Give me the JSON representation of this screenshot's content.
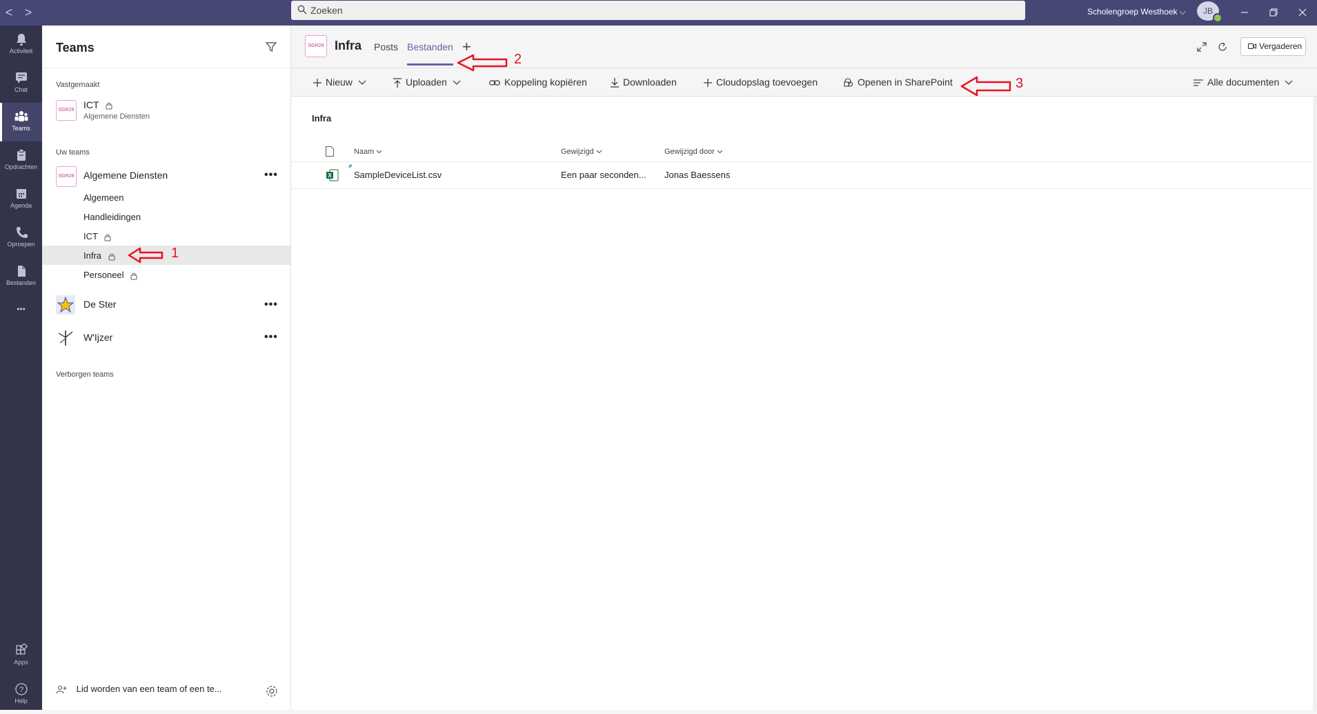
{
  "titlebar": {
    "back": "<",
    "forward": ">",
    "search_placeholder": "Zoeken",
    "org_name": "Scholengroep Westhoek ⌵",
    "avatar_initials": "JB"
  },
  "appbar": {
    "items": [
      {
        "label": "Activiteit",
        "icon": "bell-icon"
      },
      {
        "label": "Chat",
        "icon": "chat-icon"
      },
      {
        "label": "Teams",
        "icon": "teams-icon"
      },
      {
        "label": "Opdrachten",
        "icon": "assignments-icon"
      },
      {
        "label": "Agenda",
        "icon": "calendar-icon"
      },
      {
        "label": "Oproepen",
        "icon": "phone-icon"
      },
      {
        "label": "Bestanden",
        "icon": "file-icon"
      }
    ],
    "more": "•••",
    "apps_label": "Apps",
    "help_label": "Help"
  },
  "left": {
    "title": "Teams",
    "pinned_label": "Vastgemaakt",
    "pinned": {
      "icon_text": "SGR28",
      "name": "ICT",
      "sub": "Algemene Diensten"
    },
    "your_teams_label": "Uw teams",
    "team1": {
      "icon_text": "SGR28",
      "name": "Algemene Diensten",
      "channels": [
        "Algemeen",
        "Handleidingen",
        "ICT",
        "Infra",
        "Personeel"
      ]
    },
    "team2": {
      "name": "De Ster"
    },
    "team3": {
      "name": "W'Ijzer"
    },
    "more_dots": "•••",
    "hidden_label": "Verborgen teams",
    "footer": "Lid worden van een team of een te..."
  },
  "main": {
    "icon_text": "SGR28",
    "title": "Infra",
    "tabs": [
      "Posts",
      "Bestanden"
    ],
    "tab_add": "+",
    "meet_label": "Vergaderen",
    "toolbar": {
      "new": "Nieuw",
      "upload": "Uploaden",
      "copy_link": "Koppeling kopiëren",
      "download": "Downloaden",
      "add_cloud": "Cloudopslag toevoegen",
      "open_sharepoint": "Openen in SharePoint",
      "view": "Alle documenten"
    },
    "breadcrumb": "Infra",
    "columns": {
      "name": "Naam",
      "modified": "Gewijzigd",
      "modified_by": "Gewijzigd door"
    },
    "files": [
      {
        "name": "SampleDeviceList.csv",
        "modified": "Een paar seconden...",
        "modified_by": "Jonas Baessens",
        "icon": "excel-icon"
      }
    ]
  },
  "annotations": [
    "1",
    "2",
    "3"
  ],
  "colors": {
    "accent": "#6264a7",
    "titlebar": "#464775",
    "appbar": "#33344a",
    "annotation": "#e81123"
  }
}
